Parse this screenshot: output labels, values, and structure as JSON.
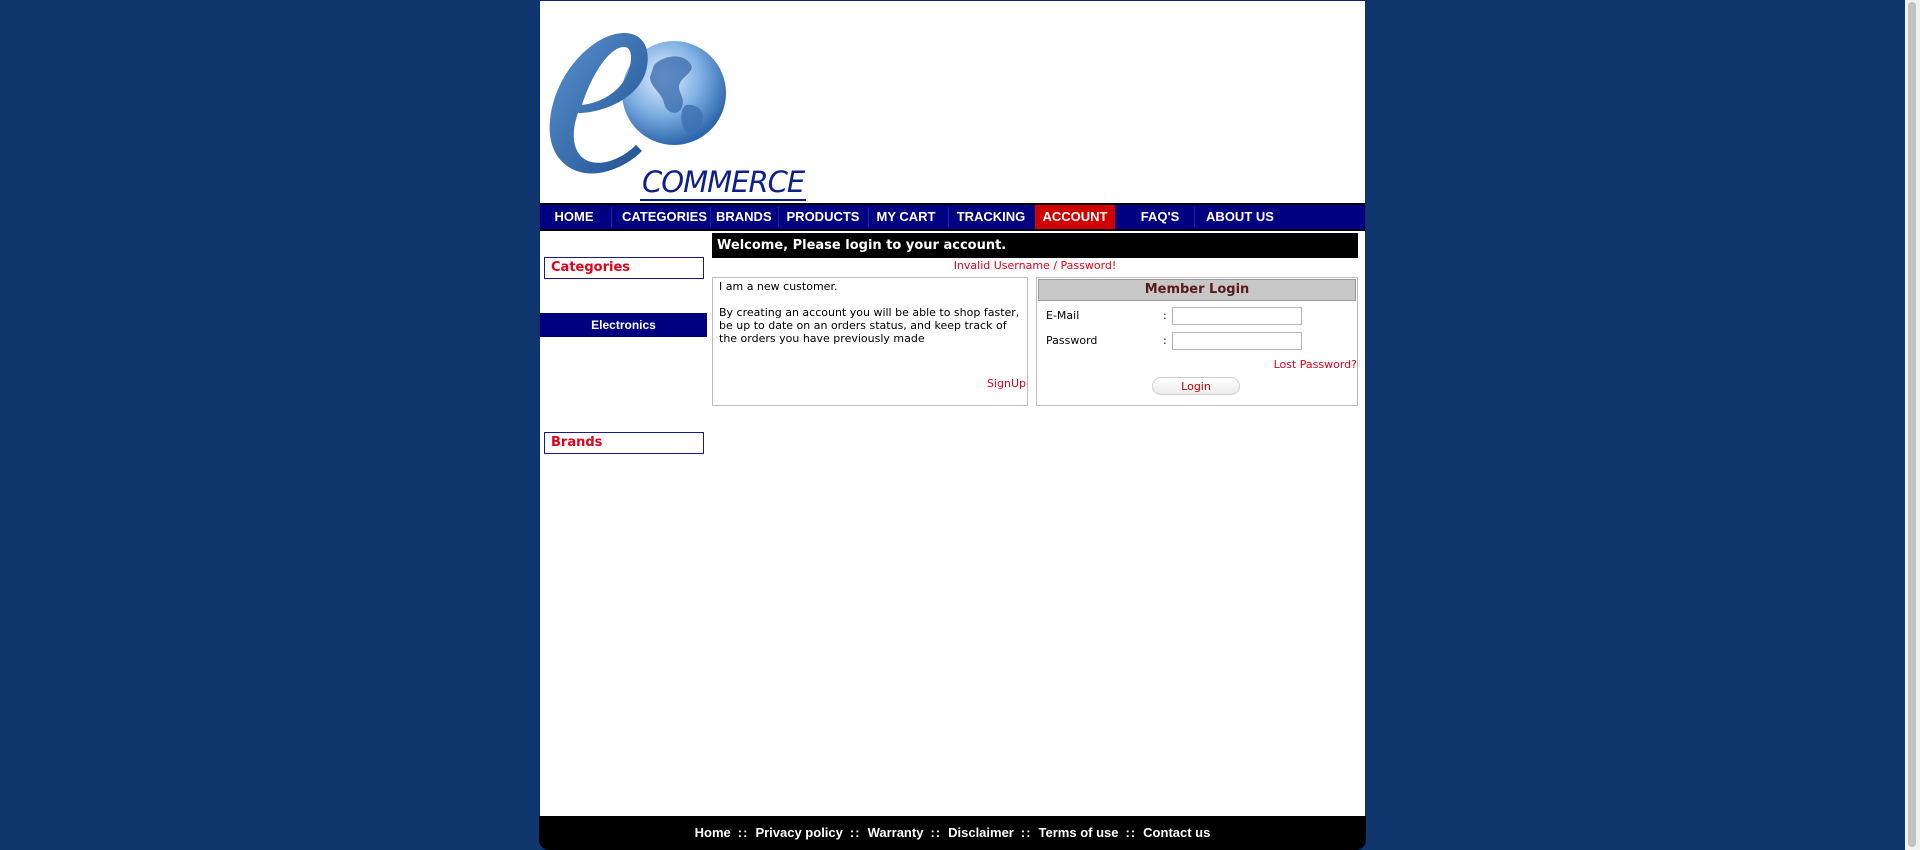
{
  "logo": {
    "text": "COMMERCE"
  },
  "nav": {
    "items": [
      {
        "label": "HOME"
      },
      {
        "label": "CATEGORIES"
      },
      {
        "label": "BRANDS"
      },
      {
        "label": "PRODUCTS"
      },
      {
        "label": "MY CART"
      },
      {
        "label": "TRACKING"
      },
      {
        "label": "ACCOUNT",
        "active": true
      },
      {
        "label": "FAQ'S"
      },
      {
        "label": "ABOUT US"
      }
    ]
  },
  "sidebar": {
    "categories_heading": "Categories",
    "categories": [
      {
        "label": "Electronics"
      }
    ],
    "brands_heading": "Brands"
  },
  "main": {
    "welcome": "Welcome, Please login to your account.",
    "error": "Invalid Username / Password!",
    "new_customer": {
      "title": "I am a new customer.",
      "body": "By creating an account you will be able to shop faster, be up to date on an orders status, and keep track of the orders you have previously made",
      "signup": "SignUp"
    },
    "login": {
      "title": "Member Login",
      "email_label": "E-Mail",
      "password_label": "Password",
      "colon": ":",
      "email_value": "",
      "password_value": "",
      "lost_password": "Lost Password?",
      "button": "Login"
    }
  },
  "footer": {
    "links": [
      "Home",
      "Privacy policy",
      "Warranty",
      "Disclaimer",
      "Terms of use",
      "Contact us"
    ],
    "separator": "::"
  },
  "colors": {
    "background": "#10366e",
    "nav": "#000080",
    "active_nav": "#d00000",
    "accent_red": "#e0001a"
  }
}
